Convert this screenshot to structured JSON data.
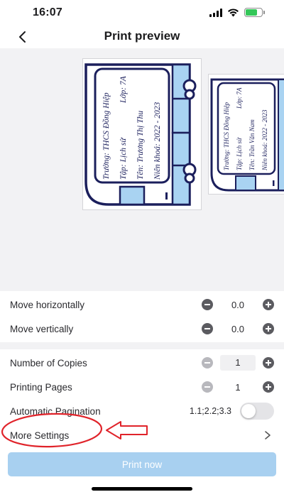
{
  "status_bar": {
    "time": "16:07"
  },
  "header": {
    "title": "Print preview"
  },
  "preview": {
    "label_1": {
      "school": "Trường:  THCS Đồng Hiệp",
      "subject": "Tập:  Lịch sử",
      "class": "Lớp:  7A",
      "name": "Tên:  Trương Thị Thu",
      "year": "Niên khoá:  2022 - 2023"
    },
    "label_2": {
      "school": "Trường:  THCS Đồng Hiệp",
      "subject": "Tập:  Lịch sử",
      "class": "Lớp:  7A",
      "name": "Tên:  Trần Văn Nam",
      "year": "Niên khoá:  2022 - 2023"
    }
  },
  "settings": {
    "move_horizontally": {
      "label": "Move horizontally",
      "value": "0.0"
    },
    "move_vertically": {
      "label": "Move vertically",
      "value": "0.0"
    },
    "copies": {
      "label": "Number of Copies",
      "value": "1"
    },
    "pages": {
      "label": "Printing Pages",
      "value": "1"
    },
    "pagination": {
      "label": "Automatic Pagination",
      "value": "1.1;2.2;3.3",
      "enabled": false
    },
    "more": {
      "label": "More Settings"
    }
  },
  "print_button": {
    "label": "Print now"
  },
  "colors": {
    "label_border": "#1b1f5c",
    "label_fill": "#a9d3f2",
    "annotation": "#e0232a",
    "print_button": "#a8d0f0"
  }
}
